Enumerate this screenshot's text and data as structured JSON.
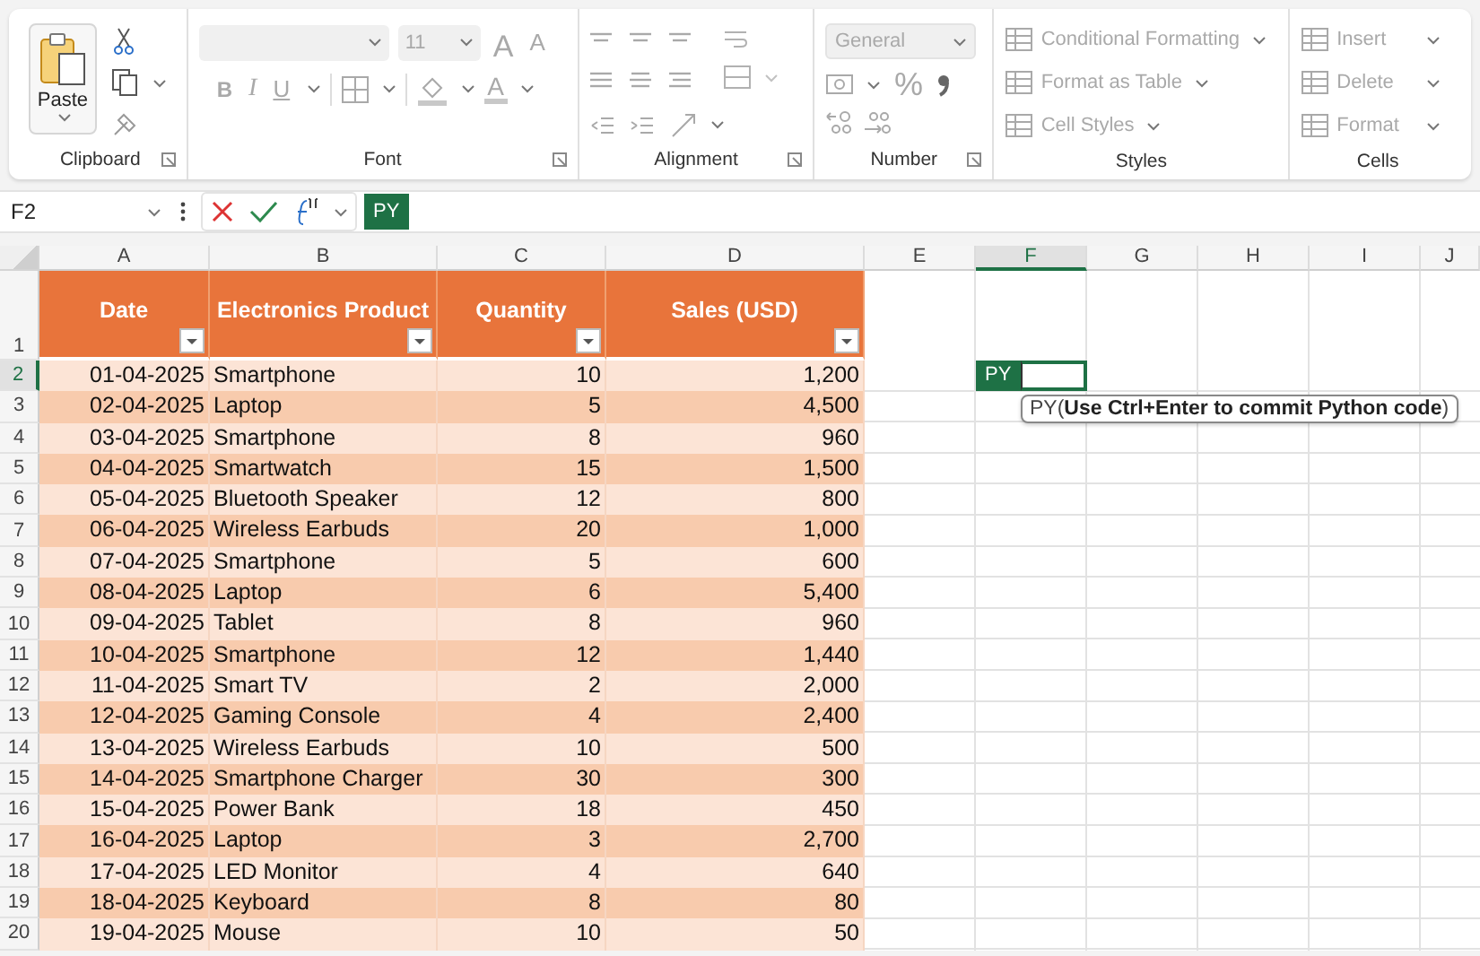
{
  "ribbon": {
    "groups": [
      {
        "kind": "clipboard",
        "label": "Clipboard",
        "disabled": false,
        "paste": "Paste"
      },
      {
        "kind": "font",
        "label": "Font",
        "disabled": true,
        "size": "11",
        "grow": "A",
        "shrink": "A",
        "bold": "B",
        "italic": "I",
        "underline": "U",
        "font_color": "A"
      },
      {
        "kind": "alignment",
        "label": "Alignment",
        "disabled": true
      },
      {
        "kind": "number",
        "label": "Number",
        "disabled": true,
        "format": "General",
        "percent": "%"
      },
      {
        "kind": "styles",
        "label": "Styles",
        "disabled": true,
        "items": [
          "Conditional Formatting",
          "Format as Table",
          "Cell Styles"
        ]
      },
      {
        "kind": "cells",
        "label": "Cells",
        "disabled": true,
        "items": [
          "Insert",
          "Delete",
          "Format"
        ]
      }
    ]
  },
  "formula_bar": {
    "name_box": "F2",
    "mode_badge": "PY"
  },
  "sheet": {
    "columns": [
      {
        "label": "A",
        "selected": false
      },
      {
        "label": "B",
        "selected": false
      },
      {
        "label": "C",
        "selected": false
      },
      {
        "label": "D",
        "selected": false
      },
      {
        "label": "E",
        "selected": false
      },
      {
        "label": "F",
        "selected": true
      },
      {
        "label": "G",
        "selected": false
      },
      {
        "label": "H",
        "selected": false
      },
      {
        "label": "I",
        "selected": false
      },
      {
        "label": "J",
        "selected": false
      }
    ],
    "table_headers": [
      "Date",
      "Electronics Product",
      "Quantity",
      "Sales (USD)"
    ],
    "rows": [
      {
        "number": "1",
        "selected": false
      },
      {
        "number": "2",
        "selected": true,
        "cells": [
          "01-04-2025",
          "Smartphone",
          "10",
          "1,200"
        ]
      },
      {
        "number": "3",
        "selected": false,
        "cells": [
          "02-04-2025",
          "Laptop",
          "5",
          "4,500"
        ]
      },
      {
        "number": "4",
        "selected": false,
        "cells": [
          "03-04-2025",
          "Smartphone",
          "8",
          "960"
        ]
      },
      {
        "number": "5",
        "selected": false,
        "cells": [
          "04-04-2025",
          "Smartwatch",
          "15",
          "1,500"
        ]
      },
      {
        "number": "6",
        "selected": false,
        "cells": [
          "05-04-2025",
          "Bluetooth Speaker",
          "12",
          "800"
        ]
      },
      {
        "number": "7",
        "selected": false,
        "cells": [
          "06-04-2025",
          "Wireless Earbuds",
          "20",
          "1,000"
        ]
      },
      {
        "number": "8",
        "selected": false,
        "cells": [
          "07-04-2025",
          "Smartphone",
          "5",
          "600"
        ]
      },
      {
        "number": "9",
        "selected": false,
        "cells": [
          "08-04-2025",
          "Laptop",
          "6",
          "5,400"
        ]
      },
      {
        "number": "10",
        "selected": false,
        "cells": [
          "09-04-2025",
          "Tablet",
          "8",
          "960"
        ]
      },
      {
        "number": "11",
        "selected": false,
        "cells": [
          "10-04-2025",
          "Smartphone",
          "12",
          "1,440"
        ]
      },
      {
        "number": "12",
        "selected": false,
        "cells": [
          "11-04-2025",
          "Smart TV",
          "2",
          "2,000"
        ]
      },
      {
        "number": "13",
        "selected": false,
        "cells": [
          "12-04-2025",
          "Gaming Console",
          "4",
          "2,400"
        ]
      },
      {
        "number": "14",
        "selected": false,
        "cells": [
          "13-04-2025",
          "Wireless Earbuds",
          "10",
          "500"
        ]
      },
      {
        "number": "15",
        "selected": false,
        "cells": [
          "14-04-2025",
          "Smartphone Charger",
          "30",
          "300"
        ]
      },
      {
        "number": "16",
        "selected": false,
        "cells": [
          "15-04-2025",
          "Power Bank",
          "18",
          "450"
        ]
      },
      {
        "number": "17",
        "selected": false,
        "cells": [
          "16-04-2025",
          "Laptop",
          "3",
          "2,700"
        ]
      },
      {
        "number": "18",
        "selected": false,
        "cells": [
          "17-04-2025",
          "LED Monitor",
          "4",
          "640"
        ]
      },
      {
        "number": "19",
        "selected": false,
        "cells": [
          "18-04-2025",
          "Keyboard",
          "8",
          "80"
        ]
      },
      {
        "number": "20",
        "selected": false,
        "cells": [
          "19-04-2025",
          "Mouse",
          "10",
          "50"
        ]
      }
    ],
    "active_cell": {
      "badge": "PY",
      "tooltip": "PY(**Use Ctrl+Enter to commit Python code**)"
    }
  }
}
